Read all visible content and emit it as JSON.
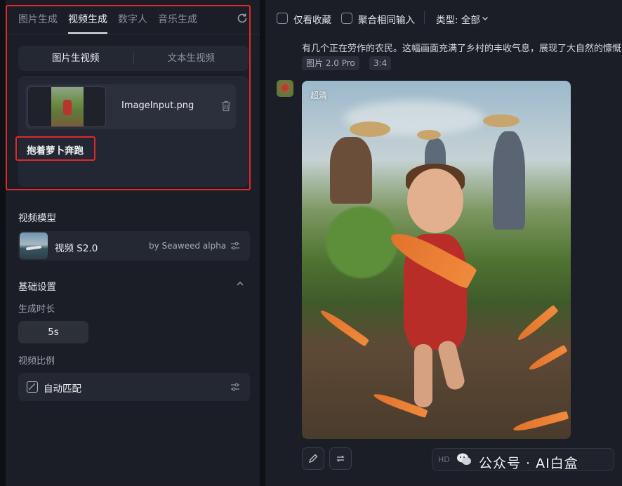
{
  "tabs": [
    "图片生成",
    "视频生成",
    "数字人",
    "音乐生成"
  ],
  "active_tab": 1,
  "mode": {
    "image_to_video": "图片生视频",
    "text_to_video": "文本生视频"
  },
  "upload": {
    "filename": "ImageInput.png",
    "prompt": "抱着萝卜奔跑"
  },
  "model": {
    "section_label": "视频模型",
    "name": "视频 S2.0",
    "by": "by Seaweed alpha"
  },
  "basic": {
    "section_label": "基础设置",
    "duration_label": "生成时长",
    "duration_value": "5s",
    "ratio_label": "视频比例",
    "ratio_value": "自动匹配"
  },
  "topbar": {
    "only_fav": "仅看收藏",
    "aggregate": "聚合相同输入",
    "type_filter": "类型: 全部"
  },
  "result": {
    "description": "有几个正在劳作的农民。这幅画面充满了乡村的丰收气息，展现了大自然的慷慨",
    "tags": [
      "图片 2.0 Pro",
      "3:4"
    ],
    "badge": "超清"
  },
  "bottom": {
    "hd": "HD",
    "watermark": "公众号 · AI白盒"
  },
  "colors": {
    "highlight": "#e0282a",
    "panel": "#1b1e26",
    "background": "#0e1015"
  }
}
